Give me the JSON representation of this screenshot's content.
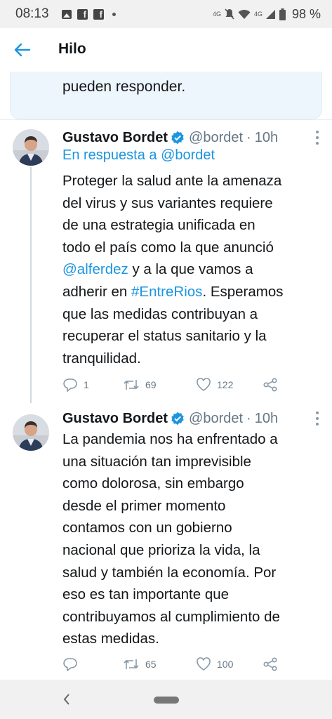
{
  "status_bar": {
    "time": "08:13",
    "left_icons": [
      "gallery-icon",
      "facebook-icon",
      "facebook-icon"
    ],
    "network_label": "4G",
    "battery_percent": "98 %"
  },
  "header": {
    "title": "Hilo"
  },
  "previous_card": {
    "text": "pueden responder."
  },
  "tweets": [
    {
      "name": "Gustavo Bordet",
      "handle": "@bordet",
      "separator": "·",
      "time": "10h",
      "reply_label": "En respuesta a",
      "reply_handle": "@bordet",
      "lines": [
        [
          {
            "t": "Proteger la salud ante la amenaza",
            "link": false
          }
        ],
        [
          {
            "t": "del virus y sus variantes requiere",
            "link": false
          }
        ],
        [
          {
            "t": "de una estrategia unificada en",
            "link": false
          }
        ],
        [
          {
            "t": "todo el país como la que anunció",
            "link": false
          }
        ],
        [
          {
            "t": "@alferdez",
            "link": true
          },
          {
            "t": " y a la que vamos a",
            "link": false
          }
        ],
        [
          {
            "t": "adherir en ",
            "link": false
          },
          {
            "t": "#EntreRios",
            "link": true
          },
          {
            "t": ". Esperamos",
            "link": false
          }
        ],
        [
          {
            "t": "que las medidas contribuyan a",
            "link": false
          }
        ],
        [
          {
            "t": "recuperar el status sanitario y la",
            "link": false
          }
        ],
        [
          {
            "t": "tranquilidad.",
            "link": false
          }
        ]
      ],
      "replies": "1",
      "retweets": "69",
      "likes": "122"
    },
    {
      "name": "Gustavo Bordet",
      "handle": "@bordet",
      "separator": "·",
      "time": "10h",
      "lines": [
        [
          {
            "t": "La pandemia nos ha enfrentado a",
            "link": false
          }
        ],
        [
          {
            "t": "una situación tan imprevisible",
            "link": false
          }
        ],
        [
          {
            "t": "como dolorosa, sin embargo",
            "link": false
          }
        ],
        [
          {
            "t": "desde el primer momento",
            "link": false
          }
        ],
        [
          {
            "t": "contamos con un gobierno",
            "link": false
          }
        ],
        [
          {
            "t": "nacional que prioriza la vida, la",
            "link": false
          }
        ],
        [
          {
            "t": "salud y también la economía. Por",
            "link": false
          }
        ],
        [
          {
            "t": "eso es tan importante que",
            "link": false
          }
        ],
        [
          {
            "t": "contribuyamos al cumplimiento de",
            "link": false
          }
        ],
        [
          {
            "t": "estas medidas.",
            "link": false
          }
        ]
      ],
      "replies": "",
      "retweets": "65",
      "likes": "100"
    }
  ],
  "colors": {
    "accent": "#1b95e0",
    "text": "#14171a",
    "muted": "#657786"
  }
}
